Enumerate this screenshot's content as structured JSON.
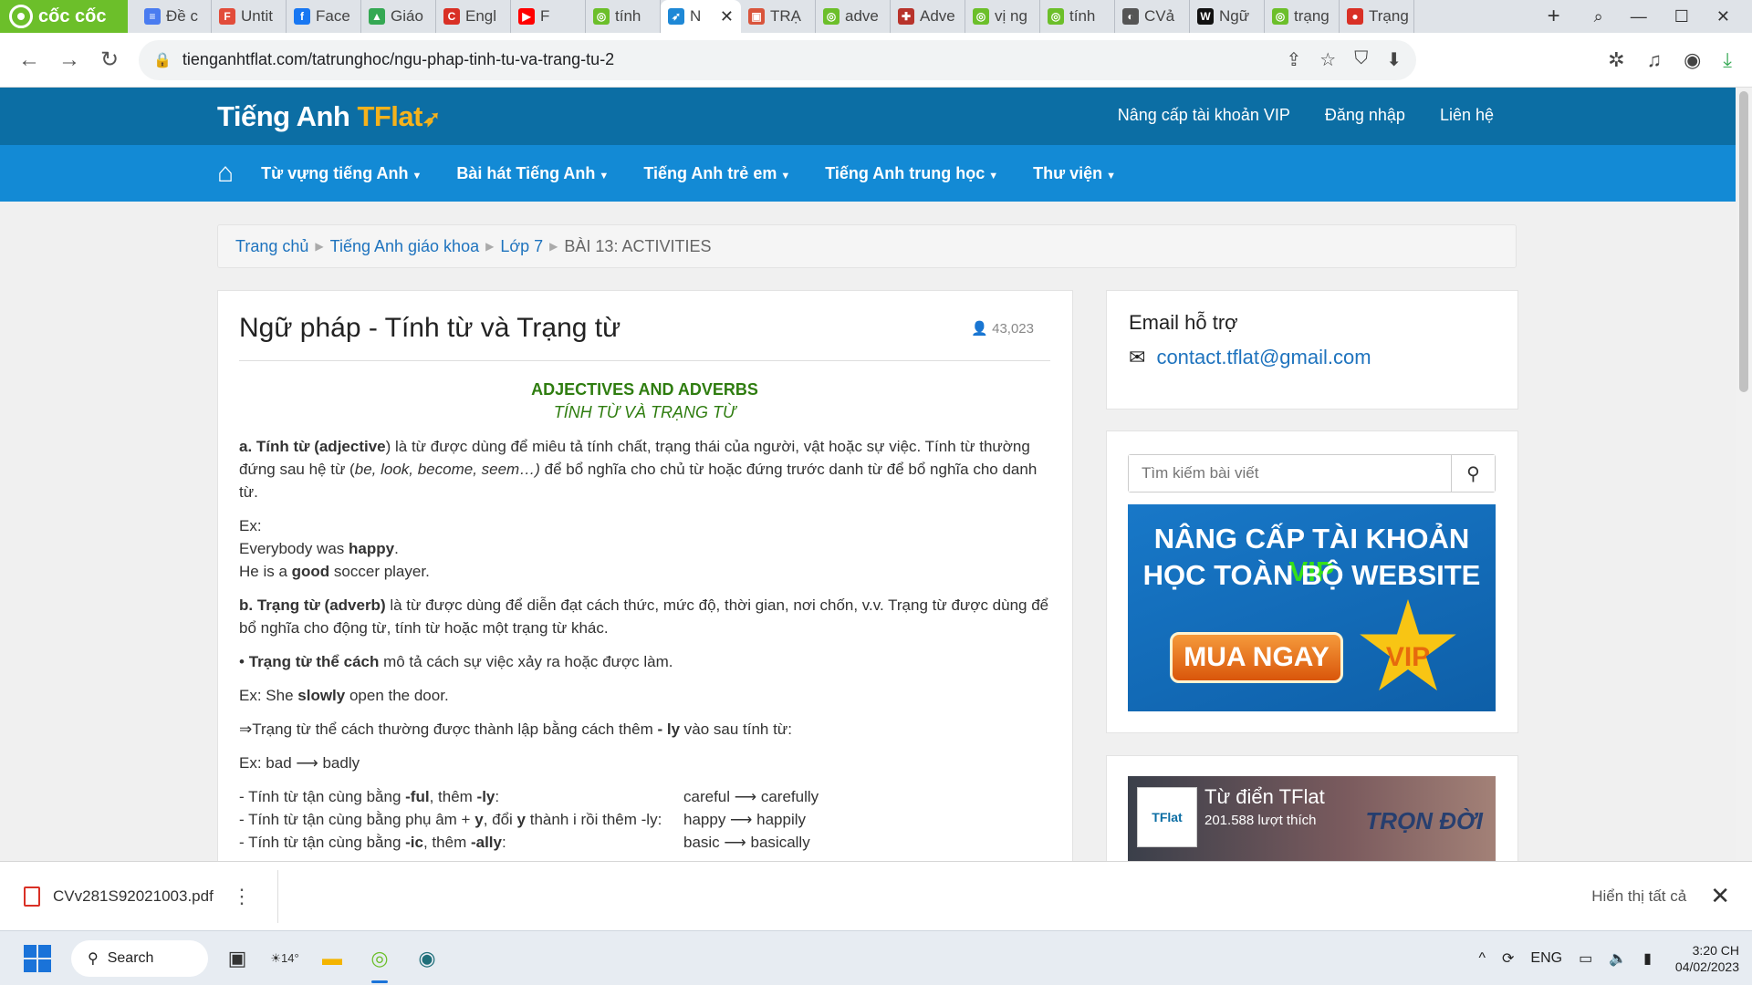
{
  "browser": {
    "brand": "cốc cốc",
    "tabs": [
      {
        "title": "Đề c",
        "color": "#4a7cf0",
        "glyph": "≡"
      },
      {
        "title": "Untit",
        "color": "#e24c3a",
        "glyph": "F"
      },
      {
        "title": "Face",
        "color": "#1877f2",
        "glyph": "f"
      },
      {
        "title": "Giáo",
        "color": "#34a853",
        "glyph": "▲"
      },
      {
        "title": "Engl",
        "color": "#d93025",
        "glyph": "C"
      },
      {
        "title": "F",
        "color": "#ff0000",
        "glyph": "▶"
      },
      {
        "title": "tính",
        "color": "#6cbf2a",
        "glyph": "◎"
      },
      {
        "title": "N",
        "color": "#1e88d6",
        "glyph": "➶"
      },
      {
        "title": "TRẠ",
        "color": "#d9553c",
        "glyph": "▣"
      },
      {
        "title": "adve",
        "color": "#6cbf2a",
        "glyph": "◎"
      },
      {
        "title": "Adve",
        "color": "#b8332b",
        "glyph": "✚"
      },
      {
        "title": "vị ng",
        "color": "#6cbf2a",
        "glyph": "◎"
      },
      {
        "title": "tính",
        "color": "#6cbf2a",
        "glyph": "◎"
      },
      {
        "title": "CVả",
        "color": "#555555",
        "glyph": "◐"
      },
      {
        "title": "Ngữ",
        "color": "#111111",
        "glyph": "W"
      },
      {
        "title": "trạng",
        "color": "#6cbf2a",
        "glyph": "◎"
      },
      {
        "title": "Trạng",
        "color": "#d93025",
        "glyph": "●"
      }
    ],
    "url": "tienganhtflat.com/tatrunghoc/ngu-phap-tinh-tu-va-trang-tu-2"
  },
  "site": {
    "logo_main": "Tiếng Anh ",
    "logo_accent": "TFlat",
    "top_links": [
      "Nâng cấp tài khoản VIP",
      "Đăng nhập",
      "Liên hệ"
    ],
    "nav": [
      "Từ vựng tiếng Anh",
      "Bài hát Tiếng Anh",
      "Tiếng Anh trẻ em",
      "Tiếng Anh trung học",
      "Thư viện"
    ]
  },
  "breadcrumb": {
    "links": [
      "Trang chủ",
      "Tiếng Anh giáo khoa",
      "Lớp 7"
    ],
    "current": "BÀI 13: ACTIVITIES"
  },
  "article": {
    "title": "Ngữ pháp - Tính từ và Trạng từ",
    "views": "43,023",
    "heading_en": "ADJECTIVES AND ADVERBS",
    "heading_vi": "TÍNH TỪ VÀ TRẠNG TỪ",
    "adj_label": "a. Tính từ (adjective",
    "adj_text1": ") là từ được dùng để miêu tả tính chất, trạng thái của người, vật hoặc sự việc. Tính từ thường đứng sau hệ từ (",
    "adj_verbs": "be, look,  become, seem…)",
    "adj_text2": " để bổ nghĩa cho chủ từ hoặc đứng trước danh từ để bổ nghĩa cho danh từ.",
    "ex_label": "Ex:",
    "ex1_pre": "Everybody was ",
    "ex1_bold": "happy",
    "ex1_post": ".",
    "ex2_pre": "He is a ",
    "ex2_bold": "good",
    "ex2_post": " soccer player.",
    "adv_label": "b. Trạng từ (adverb)",
    "adv_text": " là từ được dùng để diễn đạt cách thức, mức độ, thời gian, nơi chốn, v.v. Trạng từ được dùng để bổ nghĩa cho động từ, tính từ hoặc một trạng từ khác.",
    "manner_bullet": "• ",
    "manner_label": "Trạng từ thể cách",
    "manner_text": " mô tả cách sự việc xảy ra hoặc được làm.",
    "ex3_pre": "Ex: She ",
    "ex3_bold": "slowly",
    "ex3_post": " open the door.",
    "form_pre": "⇒Trạng từ thể cách thường được thành lập bằng cách thêm ",
    "form_bold": "- ly",
    "form_post": " vào sau tính từ:",
    "ex4": "Ex: bad ⟶ badly",
    "rules": [
      {
        "pre": " - Tính từ tận cùng bằng ",
        "b1": "-ful",
        "mid": ", thêm ",
        "b2": "-ly",
        "post": ":",
        "ex": "careful ⟶ carefully"
      },
      {
        "pre": " - Tính từ tận cùng bằng phụ âm + ",
        "b1": "y",
        "mid": ", đổi ",
        "b2": "y",
        "post": " thành i rồi thêm -ly:",
        "ex": "happy  ⟶ happily"
      },
      {
        "pre": " - Tính từ tận cùng bằng ",
        "b1": "-ic",
        "mid": ", thêm ",
        "b2": "-ally",
        "post": ":",
        "ex": "basic    ⟶ basically"
      }
    ]
  },
  "sidebar": {
    "email_heading": "Email hỗ trợ",
    "email": "contact.tflat@gmail.com",
    "search_placeholder": "Tìm kiếm bài viết",
    "vip_line1": "NÂNG CẤP TÀI KHOẢN ",
    "vip_word": "VIP",
    "vip_line2": "HỌC TOÀN BỘ WEBSITE",
    "vip_button": "MUA NGAY",
    "vip_star": "VIP",
    "fb_thumb": "TFlat",
    "fb_name": "Từ điển TFlat",
    "fb_likes": "201.588 lượt thích",
    "fb_slogan": "TRỌN ĐỜI"
  },
  "downloads": {
    "file": "CVv281S92021003.pdf",
    "show_all": "Hiển thị tất cả"
  },
  "taskbar": {
    "search": "Search",
    "weather": "14°",
    "lang": "ENG",
    "time": "3:20 CH",
    "date": "04/02/2023"
  }
}
